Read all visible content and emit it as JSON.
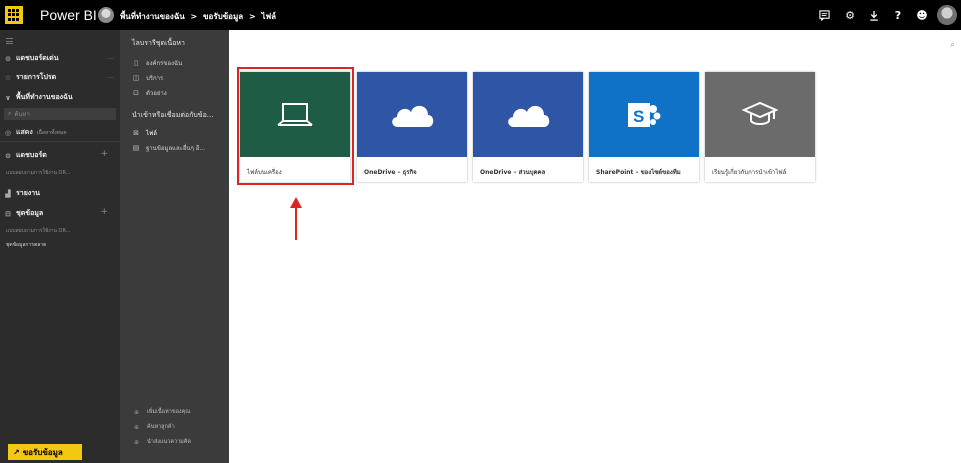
{
  "topbar": {
    "brand": "Power BI",
    "breadcrumb": [
      "พื้นที่ทำงานของฉัน",
      ">",
      "ขอรับข้อมูล",
      ">",
      "ไฟล์"
    ],
    "icons": [
      "chat-icon",
      "gear-icon",
      "download-icon",
      "help-icon",
      "smiley-icon",
      "user-avatar"
    ]
  },
  "nav": {
    "items": [
      {
        "icon": "recent-icon",
        "label": "แดชบอร์ดเด่น"
      },
      {
        "icon": "star-icon",
        "label": "รายการโปรด"
      },
      {
        "icon": "chevron-icon",
        "label": "พื้นที่ทำงานของฉัน"
      }
    ],
    "search_placeholder": "ค้นหา",
    "show_label": "แสดง",
    "show_value": "เนื้อหาทั้งหมด",
    "dashboards_label": "แดชบอร์ด",
    "dashboards_sub": "แบบสอบถามการใช้งาน OR...",
    "reports_label": "รายงาน",
    "datasets_label": "ชุดข้อมูล",
    "datasets_sub1": "แบบสอบถามการใช้งาน OR...",
    "datasets_sub2": "ชุดข้อมูลการตลาด",
    "get_data": "ขอรับข้อมูล"
  },
  "panel": {
    "library_heading": "ไลบรารีชุดเนื้อหา",
    "library_items": [
      {
        "icon": "org-icon",
        "label": "องค์กรของฉัน"
      },
      {
        "icon": "services-icon",
        "label": "บริการ"
      },
      {
        "icon": "samples-icon",
        "label": "ตัวอย่าง"
      }
    ],
    "import_heading": "นำเข้าหรือเชื่อมต่อกับข้อ...",
    "import_items": [
      {
        "icon": "files-icon",
        "label": "ไฟล์"
      },
      {
        "icon": "database-icon",
        "label": "ฐานข้อมูลและอื่นๆ อี..."
      }
    ],
    "footer_items": [
      {
        "icon": "link-icon",
        "label": "เพิ่มเนื้อหาของคุณ"
      },
      {
        "icon": "link-icon",
        "label": "ค้นหาลูกค้า"
      },
      {
        "icon": "link-icon",
        "label": "นำส่งแนวความคิด"
      }
    ]
  },
  "tiles": [
    {
      "id": "local-file",
      "caption": "ไฟล์บนเครื่อง",
      "color": "#1e5c45",
      "icon": "laptop-icon"
    },
    {
      "id": "onedrive-business",
      "caption": "OneDrive – ธุรกิจ",
      "color": "#2f56a6",
      "icon": "cloud-icon"
    },
    {
      "id": "onedrive-personal",
      "caption": "OneDrive – ส่วนบุคคล",
      "color": "#2f56a6",
      "icon": "cloud-icon"
    },
    {
      "id": "sharepoint",
      "caption": "SharePoint – ของไซต์ของทีม",
      "color": "#0f72c5",
      "icon": "sharepoint-icon"
    },
    {
      "id": "learn",
      "caption": "เรียนรู้เกี่ยวกับการนำเข้าไฟล์",
      "color": "#6b6b6b",
      "icon": "graduation-cap-icon"
    }
  ],
  "colors": {
    "topbar": "#000000",
    "nav": "#2c2c2c",
    "panel": "#3b3b3b",
    "accent": "#f2c811",
    "highlight": "#e02424"
  }
}
